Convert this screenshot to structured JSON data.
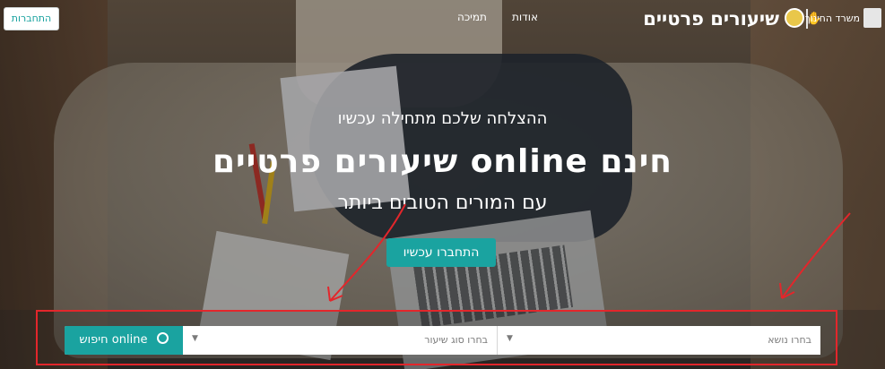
{
  "header": {
    "login_label": "התחברות",
    "nav": [
      "אודות",
      "תמיכה"
    ],
    "brand_title": "שיעורים פרטיים",
    "ministry_label": "משרד החינוך"
  },
  "hero": {
    "tagline": "ההצלחה שלכם מתחילה עכשיו",
    "headline": "שיעורים פרטיים online חינם",
    "subheadline": "עם המורים הטובים ביותר",
    "cta_label": "התחברו עכשיו"
  },
  "search": {
    "subject_placeholder": "בחרו נושא",
    "lesson_type_placeholder": "בחרו סוג שיעור",
    "button_label": "חיפוש online"
  },
  "colors": {
    "accent": "#1aa3a0",
    "annotation": "#e3262b"
  },
  "icons": [
    "search-icon",
    "owl-logo-icon",
    "state-emblem-icon",
    "chevron-down-icon"
  ]
}
